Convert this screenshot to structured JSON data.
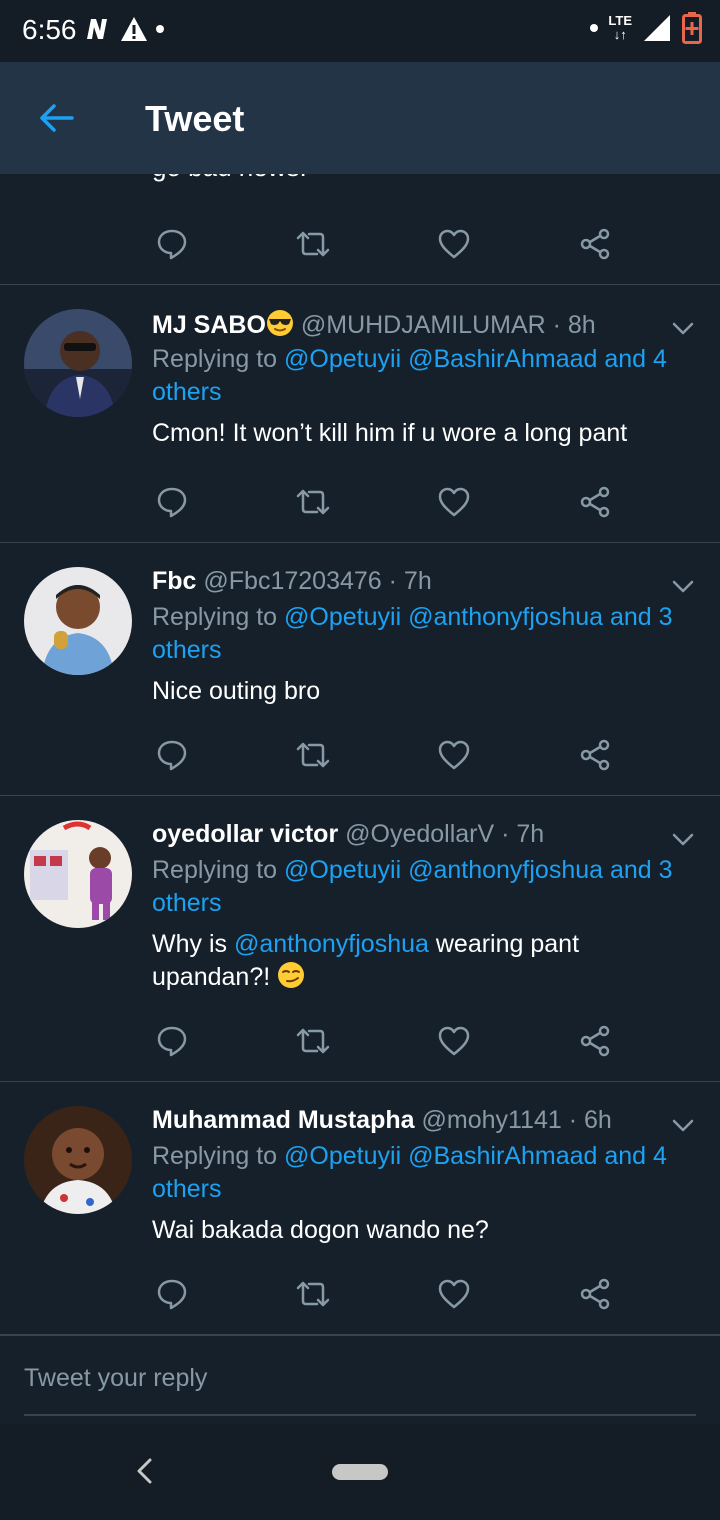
{
  "status_bar": {
    "time": "6:56",
    "network": "LTE"
  },
  "app_bar": {
    "title": "Tweet"
  },
  "partial_tweet": {
    "text": "go bad news."
  },
  "tweets": [
    {
      "name": "MJ SABO",
      "name_emoji": "😎",
      "handle": "@MUHDJAMILUMAR",
      "time": "8h",
      "replying_prefix": "Replying to ",
      "replying_mentions": "@Opetuyii @BashirAhmaad and 4 others",
      "body": "Cmon! It won’t kill him if u wore a long pant"
    },
    {
      "name": "Fbc",
      "handle": "@Fbc17203476",
      "time": "7h",
      "replying_prefix": "Replying to ",
      "replying_mentions": "@Opetuyii @anthonyfjoshua and 3 others",
      "body": "Nice outing bro"
    },
    {
      "name": "oyedollar victor",
      "handle": "@OyedollarV",
      "time": "7h",
      "replying_prefix": "Replying to ",
      "replying_mentions": "@Opetuyii @anthonyfjoshua and 3 others",
      "body_before": "Why is ",
      "body_mention": "@anthonyfjoshua",
      "body_after": " wearing pant upandan?! ",
      "body_emoji": "😏"
    },
    {
      "name": "Muhammad Mustapha",
      "handle": "@mohy1141",
      "time": "6h",
      "replying_prefix": "Replying to ",
      "replying_mentions": "@Opetuyii @BashirAhmaad and 4 others",
      "body": "Wai bakada dogon wando ne?"
    }
  ],
  "reply_bar": {
    "placeholder": "Tweet your reply"
  },
  "icons": {
    "back": "arrow-left-icon",
    "reply": "reply-icon",
    "retweet": "retweet-icon",
    "like": "heart-icon",
    "share": "share-icon",
    "more": "chevron-down-icon"
  },
  "colors": {
    "background": "#15202b",
    "app_bar": "#243447",
    "accent": "#1da1f2",
    "secondary_text": "#8899a6",
    "divider": "#38444d"
  }
}
